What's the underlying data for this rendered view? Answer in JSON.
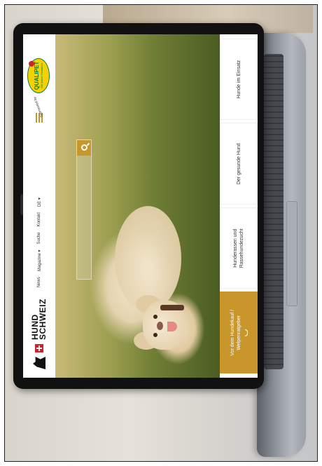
{
  "site": {
    "logo": {
      "line1": "HUND",
      "line2": "SCHWEIZ"
    },
    "nav": [
      "News",
      "Magazine ▾",
      "Suche",
      "Kontakt",
      "DE ▾"
    ],
    "sponsor": {
      "label": "Sponsored by",
      "brand": "QUALIPET",
      "slogan": "Wir lieben Heimtiere"
    },
    "search": {
      "placeholder": ""
    },
    "tiles": [
      {
        "label": "Vor dem Hundekauf / Welpenratgeber",
        "active": true
      },
      {
        "label": "Hunderassen und Rassehundezucht",
        "active": false
      },
      {
        "label": "Der gesunde Hund",
        "active": false
      },
      {
        "label": "Hunde im Einsatz",
        "active": false
      }
    ],
    "colors": {
      "accent": "#c8962b",
      "brand_red": "#d0202a",
      "sponsor_yellow": "#f2d200",
      "sponsor_green": "#0a7e3a"
    }
  }
}
